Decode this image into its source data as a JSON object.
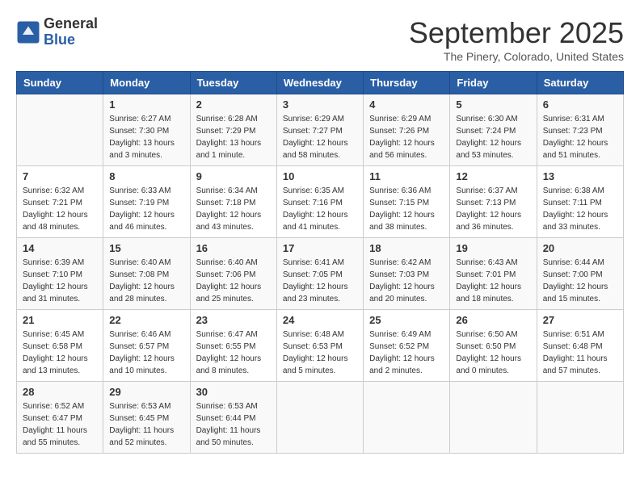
{
  "header": {
    "logo_general": "General",
    "logo_blue": "Blue",
    "month": "September 2025",
    "location": "The Pinery, Colorado, United States"
  },
  "weekdays": [
    "Sunday",
    "Monday",
    "Tuesday",
    "Wednesday",
    "Thursday",
    "Friday",
    "Saturday"
  ],
  "weeks": [
    [
      {
        "day": "",
        "info": ""
      },
      {
        "day": "1",
        "info": "Sunrise: 6:27 AM\nSunset: 7:30 PM\nDaylight: 13 hours\nand 3 minutes."
      },
      {
        "day": "2",
        "info": "Sunrise: 6:28 AM\nSunset: 7:29 PM\nDaylight: 13 hours\nand 1 minute."
      },
      {
        "day": "3",
        "info": "Sunrise: 6:29 AM\nSunset: 7:27 PM\nDaylight: 12 hours\nand 58 minutes."
      },
      {
        "day": "4",
        "info": "Sunrise: 6:29 AM\nSunset: 7:26 PM\nDaylight: 12 hours\nand 56 minutes."
      },
      {
        "day": "5",
        "info": "Sunrise: 6:30 AM\nSunset: 7:24 PM\nDaylight: 12 hours\nand 53 minutes."
      },
      {
        "day": "6",
        "info": "Sunrise: 6:31 AM\nSunset: 7:23 PM\nDaylight: 12 hours\nand 51 minutes."
      }
    ],
    [
      {
        "day": "7",
        "info": "Sunrise: 6:32 AM\nSunset: 7:21 PM\nDaylight: 12 hours\nand 48 minutes."
      },
      {
        "day": "8",
        "info": "Sunrise: 6:33 AM\nSunset: 7:19 PM\nDaylight: 12 hours\nand 46 minutes."
      },
      {
        "day": "9",
        "info": "Sunrise: 6:34 AM\nSunset: 7:18 PM\nDaylight: 12 hours\nand 43 minutes."
      },
      {
        "day": "10",
        "info": "Sunrise: 6:35 AM\nSunset: 7:16 PM\nDaylight: 12 hours\nand 41 minutes."
      },
      {
        "day": "11",
        "info": "Sunrise: 6:36 AM\nSunset: 7:15 PM\nDaylight: 12 hours\nand 38 minutes."
      },
      {
        "day": "12",
        "info": "Sunrise: 6:37 AM\nSunset: 7:13 PM\nDaylight: 12 hours\nand 36 minutes."
      },
      {
        "day": "13",
        "info": "Sunrise: 6:38 AM\nSunset: 7:11 PM\nDaylight: 12 hours\nand 33 minutes."
      }
    ],
    [
      {
        "day": "14",
        "info": "Sunrise: 6:39 AM\nSunset: 7:10 PM\nDaylight: 12 hours\nand 31 minutes."
      },
      {
        "day": "15",
        "info": "Sunrise: 6:40 AM\nSunset: 7:08 PM\nDaylight: 12 hours\nand 28 minutes."
      },
      {
        "day": "16",
        "info": "Sunrise: 6:40 AM\nSunset: 7:06 PM\nDaylight: 12 hours\nand 25 minutes."
      },
      {
        "day": "17",
        "info": "Sunrise: 6:41 AM\nSunset: 7:05 PM\nDaylight: 12 hours\nand 23 minutes."
      },
      {
        "day": "18",
        "info": "Sunrise: 6:42 AM\nSunset: 7:03 PM\nDaylight: 12 hours\nand 20 minutes."
      },
      {
        "day": "19",
        "info": "Sunrise: 6:43 AM\nSunset: 7:01 PM\nDaylight: 12 hours\nand 18 minutes."
      },
      {
        "day": "20",
        "info": "Sunrise: 6:44 AM\nSunset: 7:00 PM\nDaylight: 12 hours\nand 15 minutes."
      }
    ],
    [
      {
        "day": "21",
        "info": "Sunrise: 6:45 AM\nSunset: 6:58 PM\nDaylight: 12 hours\nand 13 minutes."
      },
      {
        "day": "22",
        "info": "Sunrise: 6:46 AM\nSunset: 6:57 PM\nDaylight: 12 hours\nand 10 minutes."
      },
      {
        "day": "23",
        "info": "Sunrise: 6:47 AM\nSunset: 6:55 PM\nDaylight: 12 hours\nand 8 minutes."
      },
      {
        "day": "24",
        "info": "Sunrise: 6:48 AM\nSunset: 6:53 PM\nDaylight: 12 hours\nand 5 minutes."
      },
      {
        "day": "25",
        "info": "Sunrise: 6:49 AM\nSunset: 6:52 PM\nDaylight: 12 hours\nand 2 minutes."
      },
      {
        "day": "26",
        "info": "Sunrise: 6:50 AM\nSunset: 6:50 PM\nDaylight: 12 hours\nand 0 minutes."
      },
      {
        "day": "27",
        "info": "Sunrise: 6:51 AM\nSunset: 6:48 PM\nDaylight: 11 hours\nand 57 minutes."
      }
    ],
    [
      {
        "day": "28",
        "info": "Sunrise: 6:52 AM\nSunset: 6:47 PM\nDaylight: 11 hours\nand 55 minutes."
      },
      {
        "day": "29",
        "info": "Sunrise: 6:53 AM\nSunset: 6:45 PM\nDaylight: 11 hours\nand 52 minutes."
      },
      {
        "day": "30",
        "info": "Sunrise: 6:53 AM\nSunset: 6:44 PM\nDaylight: 11 hours\nand 50 minutes."
      },
      {
        "day": "",
        "info": ""
      },
      {
        "day": "",
        "info": ""
      },
      {
        "day": "",
        "info": ""
      },
      {
        "day": "",
        "info": ""
      }
    ]
  ]
}
